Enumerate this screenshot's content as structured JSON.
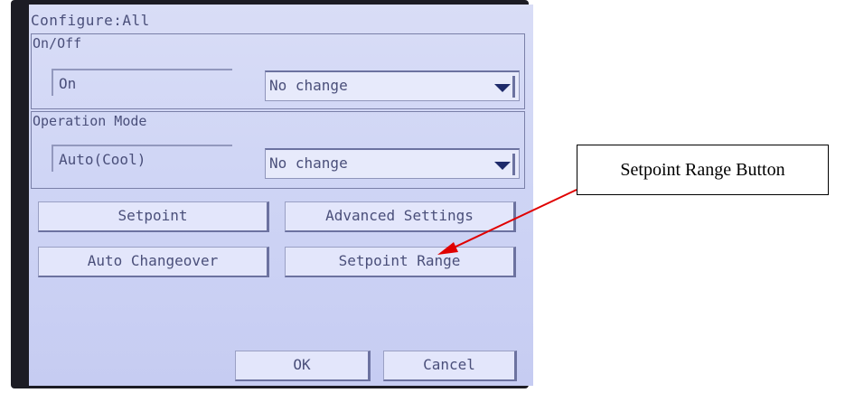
{
  "screen": {
    "title": "Configure:All",
    "on_off": {
      "label": "On/Off",
      "current_value": "On",
      "select_value": "No change"
    },
    "operation_mode": {
      "label": "Operation Mode",
      "current_value": "Auto(Cool)",
      "select_value": "No change"
    },
    "buttons": {
      "setpoint": "Setpoint",
      "advanced_settings": "Advanced Settings",
      "auto_changeover": "Auto Changeover",
      "setpoint_range": "Setpoint Range",
      "ok": "OK",
      "cancel": "Cancel"
    }
  },
  "callout": {
    "text": "Setpoint Range Button"
  },
  "colors": {
    "screen_bg": "#cfd5f5",
    "text": "#4a4f7a",
    "arrow": "#e00000"
  },
  "icons": {
    "dropdown": "chevron-down-icon"
  }
}
